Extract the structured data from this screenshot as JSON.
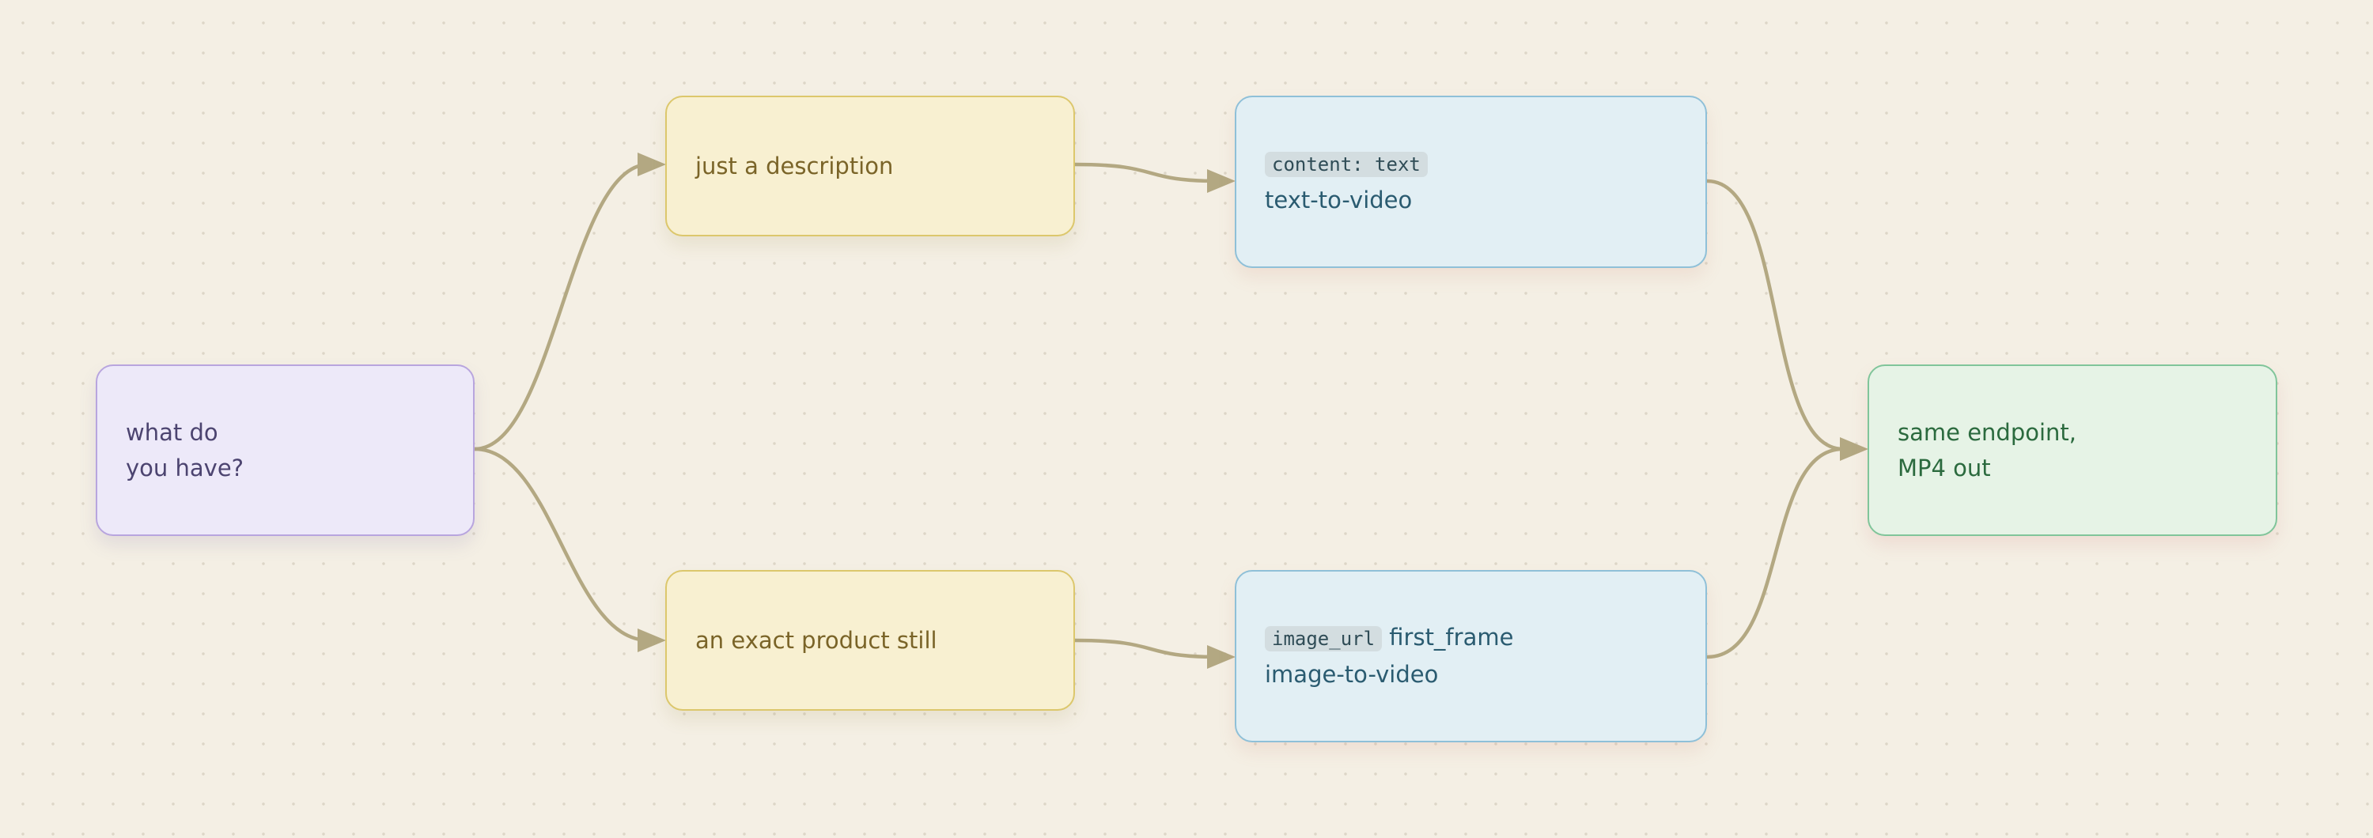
{
  "nodes": {
    "question": {
      "line1": "what do",
      "line2": "you have?"
    },
    "description": {
      "label": "just a description"
    },
    "product_still": {
      "label": "an exact product still"
    },
    "text_to_video": {
      "code": "content: text",
      "label": "text-to-video"
    },
    "image_to_video": {
      "code": "image_url",
      "code_suffix": "first_frame",
      "label": "image-to-video"
    },
    "output": {
      "line1": "same endpoint,",
      "line2": "MP4 out"
    }
  },
  "edges": [
    {
      "from": "question",
      "to": "description"
    },
    {
      "from": "question",
      "to": "product_still"
    },
    {
      "from": "description",
      "to": "text_to_video"
    },
    {
      "from": "product_still",
      "to": "image_to_video"
    },
    {
      "from": "text_to_video",
      "to": "output"
    },
    {
      "from": "image_to_video",
      "to": "output"
    }
  ],
  "colors": {
    "background": "#f4efe4",
    "edge": "#b3a882",
    "question": "#ede9f9",
    "choice": "#f8f0d1",
    "mode": "#e2eff4",
    "output": "#e6f3e6"
  }
}
